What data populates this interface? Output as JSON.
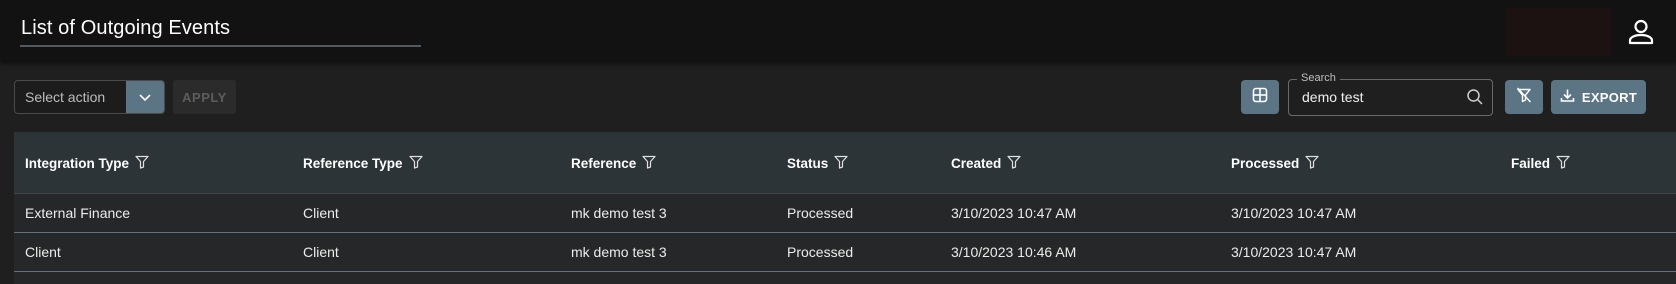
{
  "header": {
    "title": "List of Outgoing Events"
  },
  "toolbar": {
    "select_action_placeholder": "Select action",
    "apply_label": "APPLY",
    "search_label": "Search",
    "search_value": "demo test",
    "export_label": "EXPORT"
  },
  "icons": {
    "user": "user-icon",
    "chevron": "chevron-down-icon",
    "grid": "grid-layout-icon",
    "search": "search-icon",
    "filter_clear": "filter-clear-icon",
    "export": "download-icon",
    "column_filter": "filter-funnel-icon"
  },
  "colors": {
    "accent": "#5b7585",
    "header_bg": "#2d3438",
    "row_border": "#5e7380"
  },
  "table": {
    "columns": [
      "Integration Type",
      "Reference Type",
      "Reference",
      "Status",
      "Created",
      "Processed",
      "Failed"
    ],
    "rows": [
      [
        "External Finance",
        "Client",
        "mk demo test 3",
        "Processed",
        "3/10/2023 10:47 AM",
        "3/10/2023 10:47 AM",
        ""
      ],
      [
        "Client",
        "Client",
        "mk demo test 3",
        "Processed",
        "3/10/2023 10:46 AM",
        "3/10/2023 10:47 AM",
        ""
      ]
    ]
  }
}
